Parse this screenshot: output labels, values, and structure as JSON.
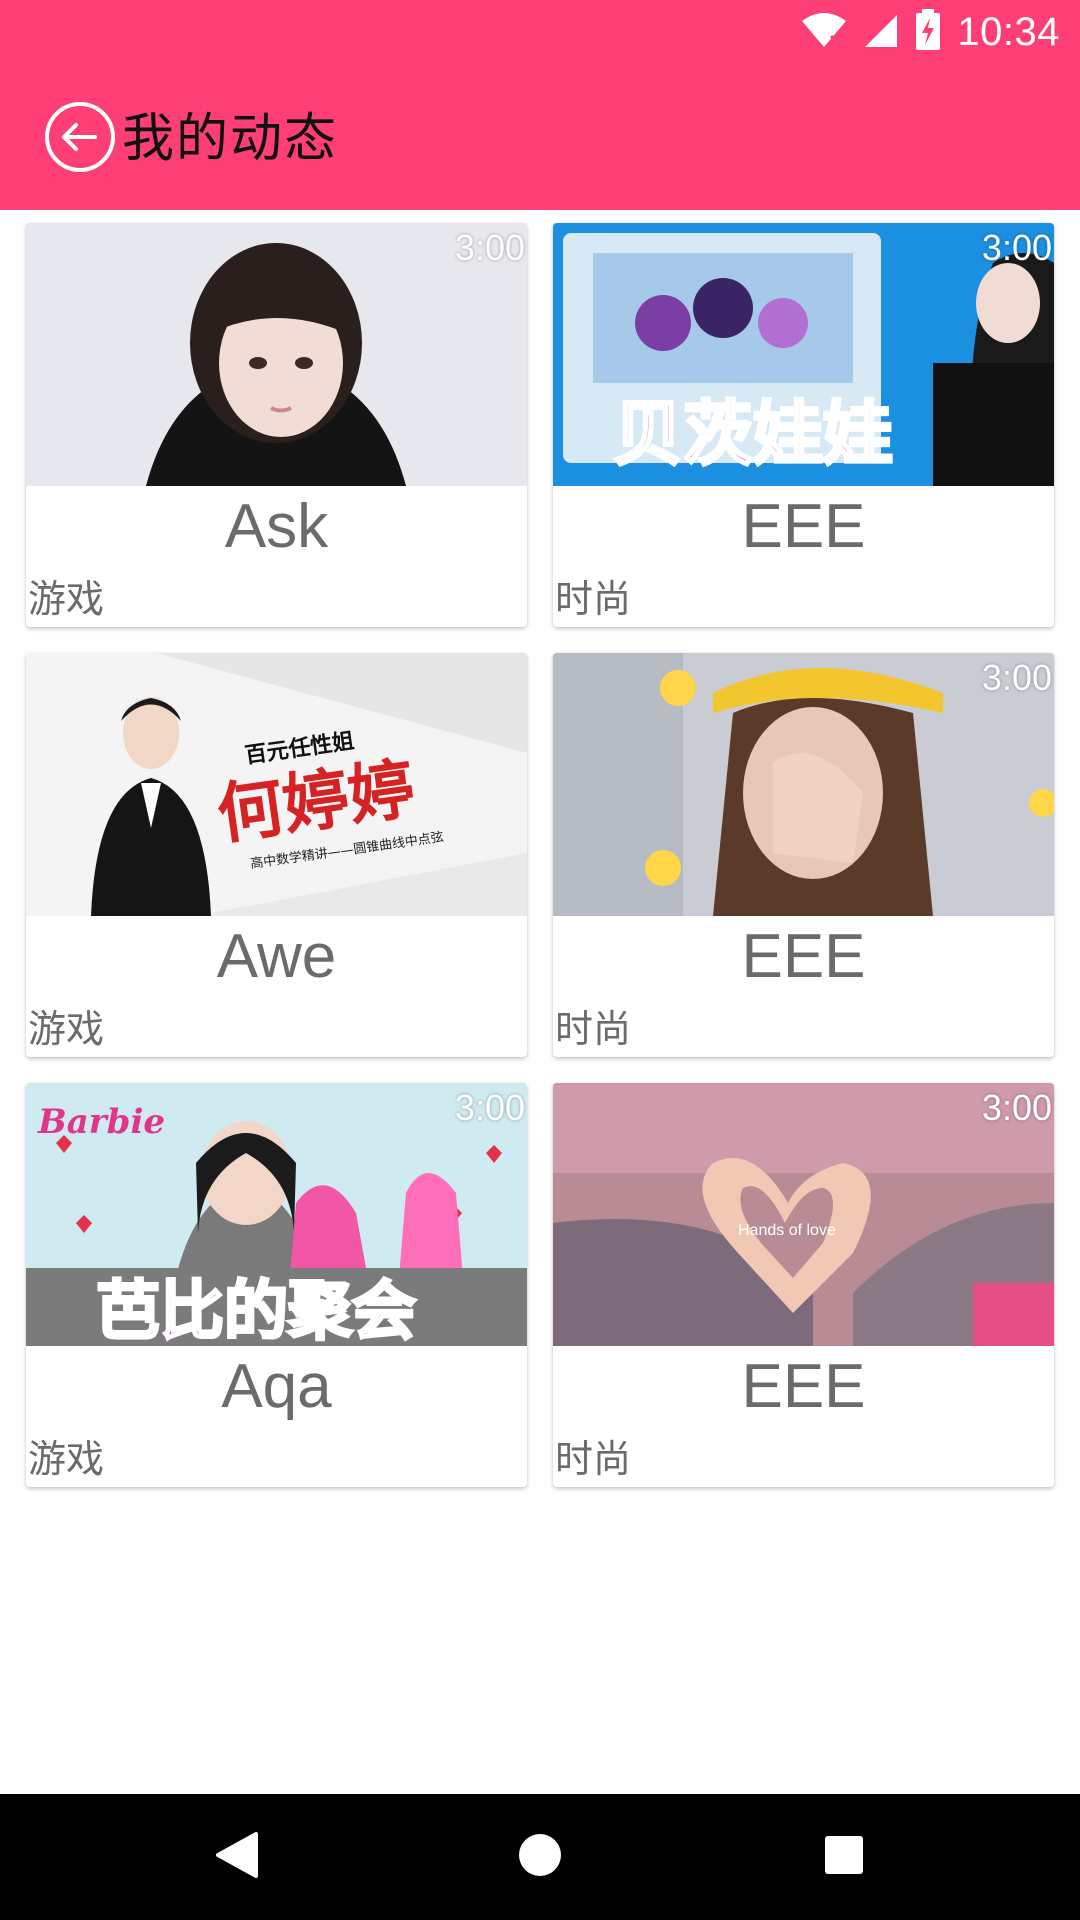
{
  "status_bar": {
    "time": "10:34",
    "icons": [
      "wifi-icon",
      "cellular-signal-icon",
      "battery-charging-icon"
    ]
  },
  "toolbar": {
    "title": "我的动态",
    "back_icon": "back-arrow-circle-icon"
  },
  "colors": {
    "header": "#fd3f76",
    "text_gray": "#6b6b6b",
    "nav_bar": "#000000"
  },
  "cards": [
    {
      "title": "Ask",
      "category": "游戏",
      "duration": "3:00"
    },
    {
      "title": "EEE",
      "category": "时尚",
      "duration": "3:00"
    },
    {
      "title": "Awe",
      "category": "游戏",
      "duration": ""
    },
    {
      "title": "EEE",
      "category": "时尚",
      "duration": "3:00"
    },
    {
      "title": "Aqa",
      "category": "游戏",
      "duration": "3:00"
    },
    {
      "title": "EEE",
      "category": "时尚",
      "duration": "3:00"
    }
  ],
  "thumbnails": {
    "card2_banner_text": "贝茨娃娃",
    "card3_caption_small": "百元任性姐",
    "card3_caption_large": "何婷婷",
    "card3_caption_sub": "高中数学精讲——圆锥曲线中点弦",
    "card5_brand": "Barbie",
    "card5_banner_text": "芭比的聚会",
    "card6_caption": "Hands of love"
  },
  "nav_bar": {
    "icons": [
      "back-triangle-icon",
      "home-circle-icon",
      "recents-square-icon"
    ]
  }
}
